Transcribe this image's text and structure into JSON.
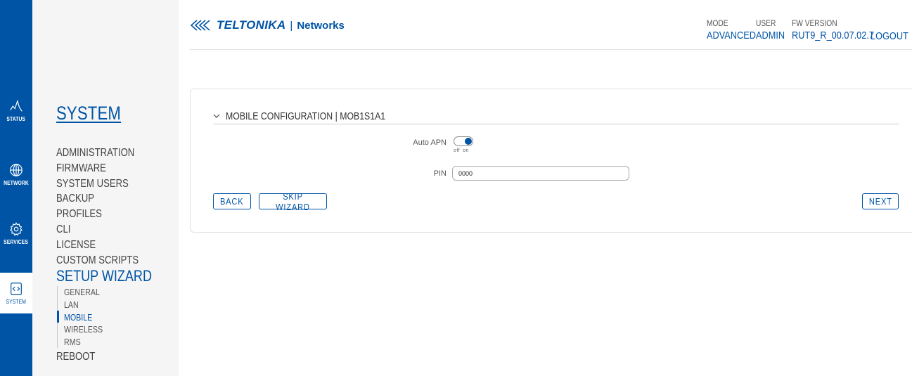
{
  "colors": {
    "accent": "#0054a6",
    "rail_bg": "#0054a6",
    "sidebar_bg": "#f5f5f5",
    "toggle_on": "#0054a6"
  },
  "rail": {
    "items": [
      {
        "label": "STATUS",
        "icon": "pulse-icon"
      },
      {
        "label": "NETWORK",
        "icon": "globe-icon"
      },
      {
        "label": "SERVICES",
        "icon": "gear-icon"
      },
      {
        "label": "SYSTEM",
        "icon": "code-icon",
        "active": true
      }
    ]
  },
  "sidebar": {
    "title": "SYSTEM",
    "items": [
      "ADMINISTRATION",
      "FIRMWARE",
      "SYSTEM USERS",
      "BACKUP",
      "PROFILES",
      "CLI",
      "LICENSE",
      "CUSTOM SCRIPTS"
    ],
    "active_group": "SETUP WIZARD",
    "sub_items": [
      "GENERAL",
      "LAN",
      "MOBILE",
      "WIRELESS",
      "RMS"
    ],
    "active_sub": "MOBILE",
    "after_items": [
      "REBOOT"
    ]
  },
  "header": {
    "brand": "TELTONIKA",
    "brand_separator": "|",
    "brand_sub": "Networks",
    "mode_label": "MODE",
    "mode_value": "ADVANCED",
    "user_label": "USER",
    "user_value": "ADMIN",
    "fw_label": "FW VERSION",
    "fw_value": "RUT9_R_00.07.02.7",
    "logout": "LOGOUT"
  },
  "section": {
    "title": "MOBILE CONFIGURATION | MOB1S1A1",
    "auto_apn_label": "Auto APN",
    "auto_apn_on": true,
    "toggle_off": "off",
    "toggle_on": "on",
    "pin_label": "PIN",
    "pin_value": "0000"
  },
  "buttons": {
    "back": "BACK",
    "skip": "SKIP WIZARD",
    "next": "NEXT"
  }
}
